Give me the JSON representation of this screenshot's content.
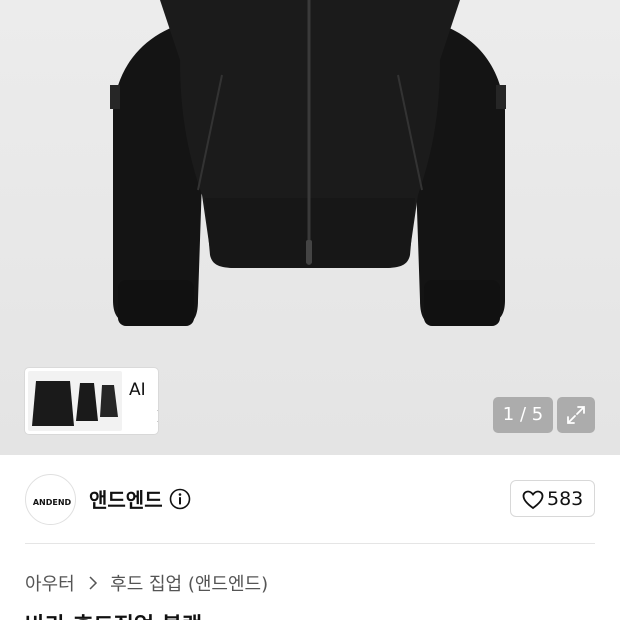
{
  "gallery": {
    "ai_label": "AI",
    "counter": "1 / 5"
  },
  "brand": {
    "name": "앤드엔드",
    "logo_text": "ANDEND",
    "like_count": "583"
  },
  "breadcrumb": {
    "items": [
      "아우터",
      "후드 집업 (앤드엔드)"
    ]
  },
  "product": {
    "title": "바라 후드집업 블랙"
  },
  "colors": {
    "hero_bg": "#e8e8e8",
    "jacket": "#1a1a1a",
    "counter_bg": "#969696"
  },
  "icons": {
    "info": "info-icon",
    "heart": "heart-outline-icon",
    "expand": "expand-icon",
    "chevron": "chevron-right-icon"
  }
}
